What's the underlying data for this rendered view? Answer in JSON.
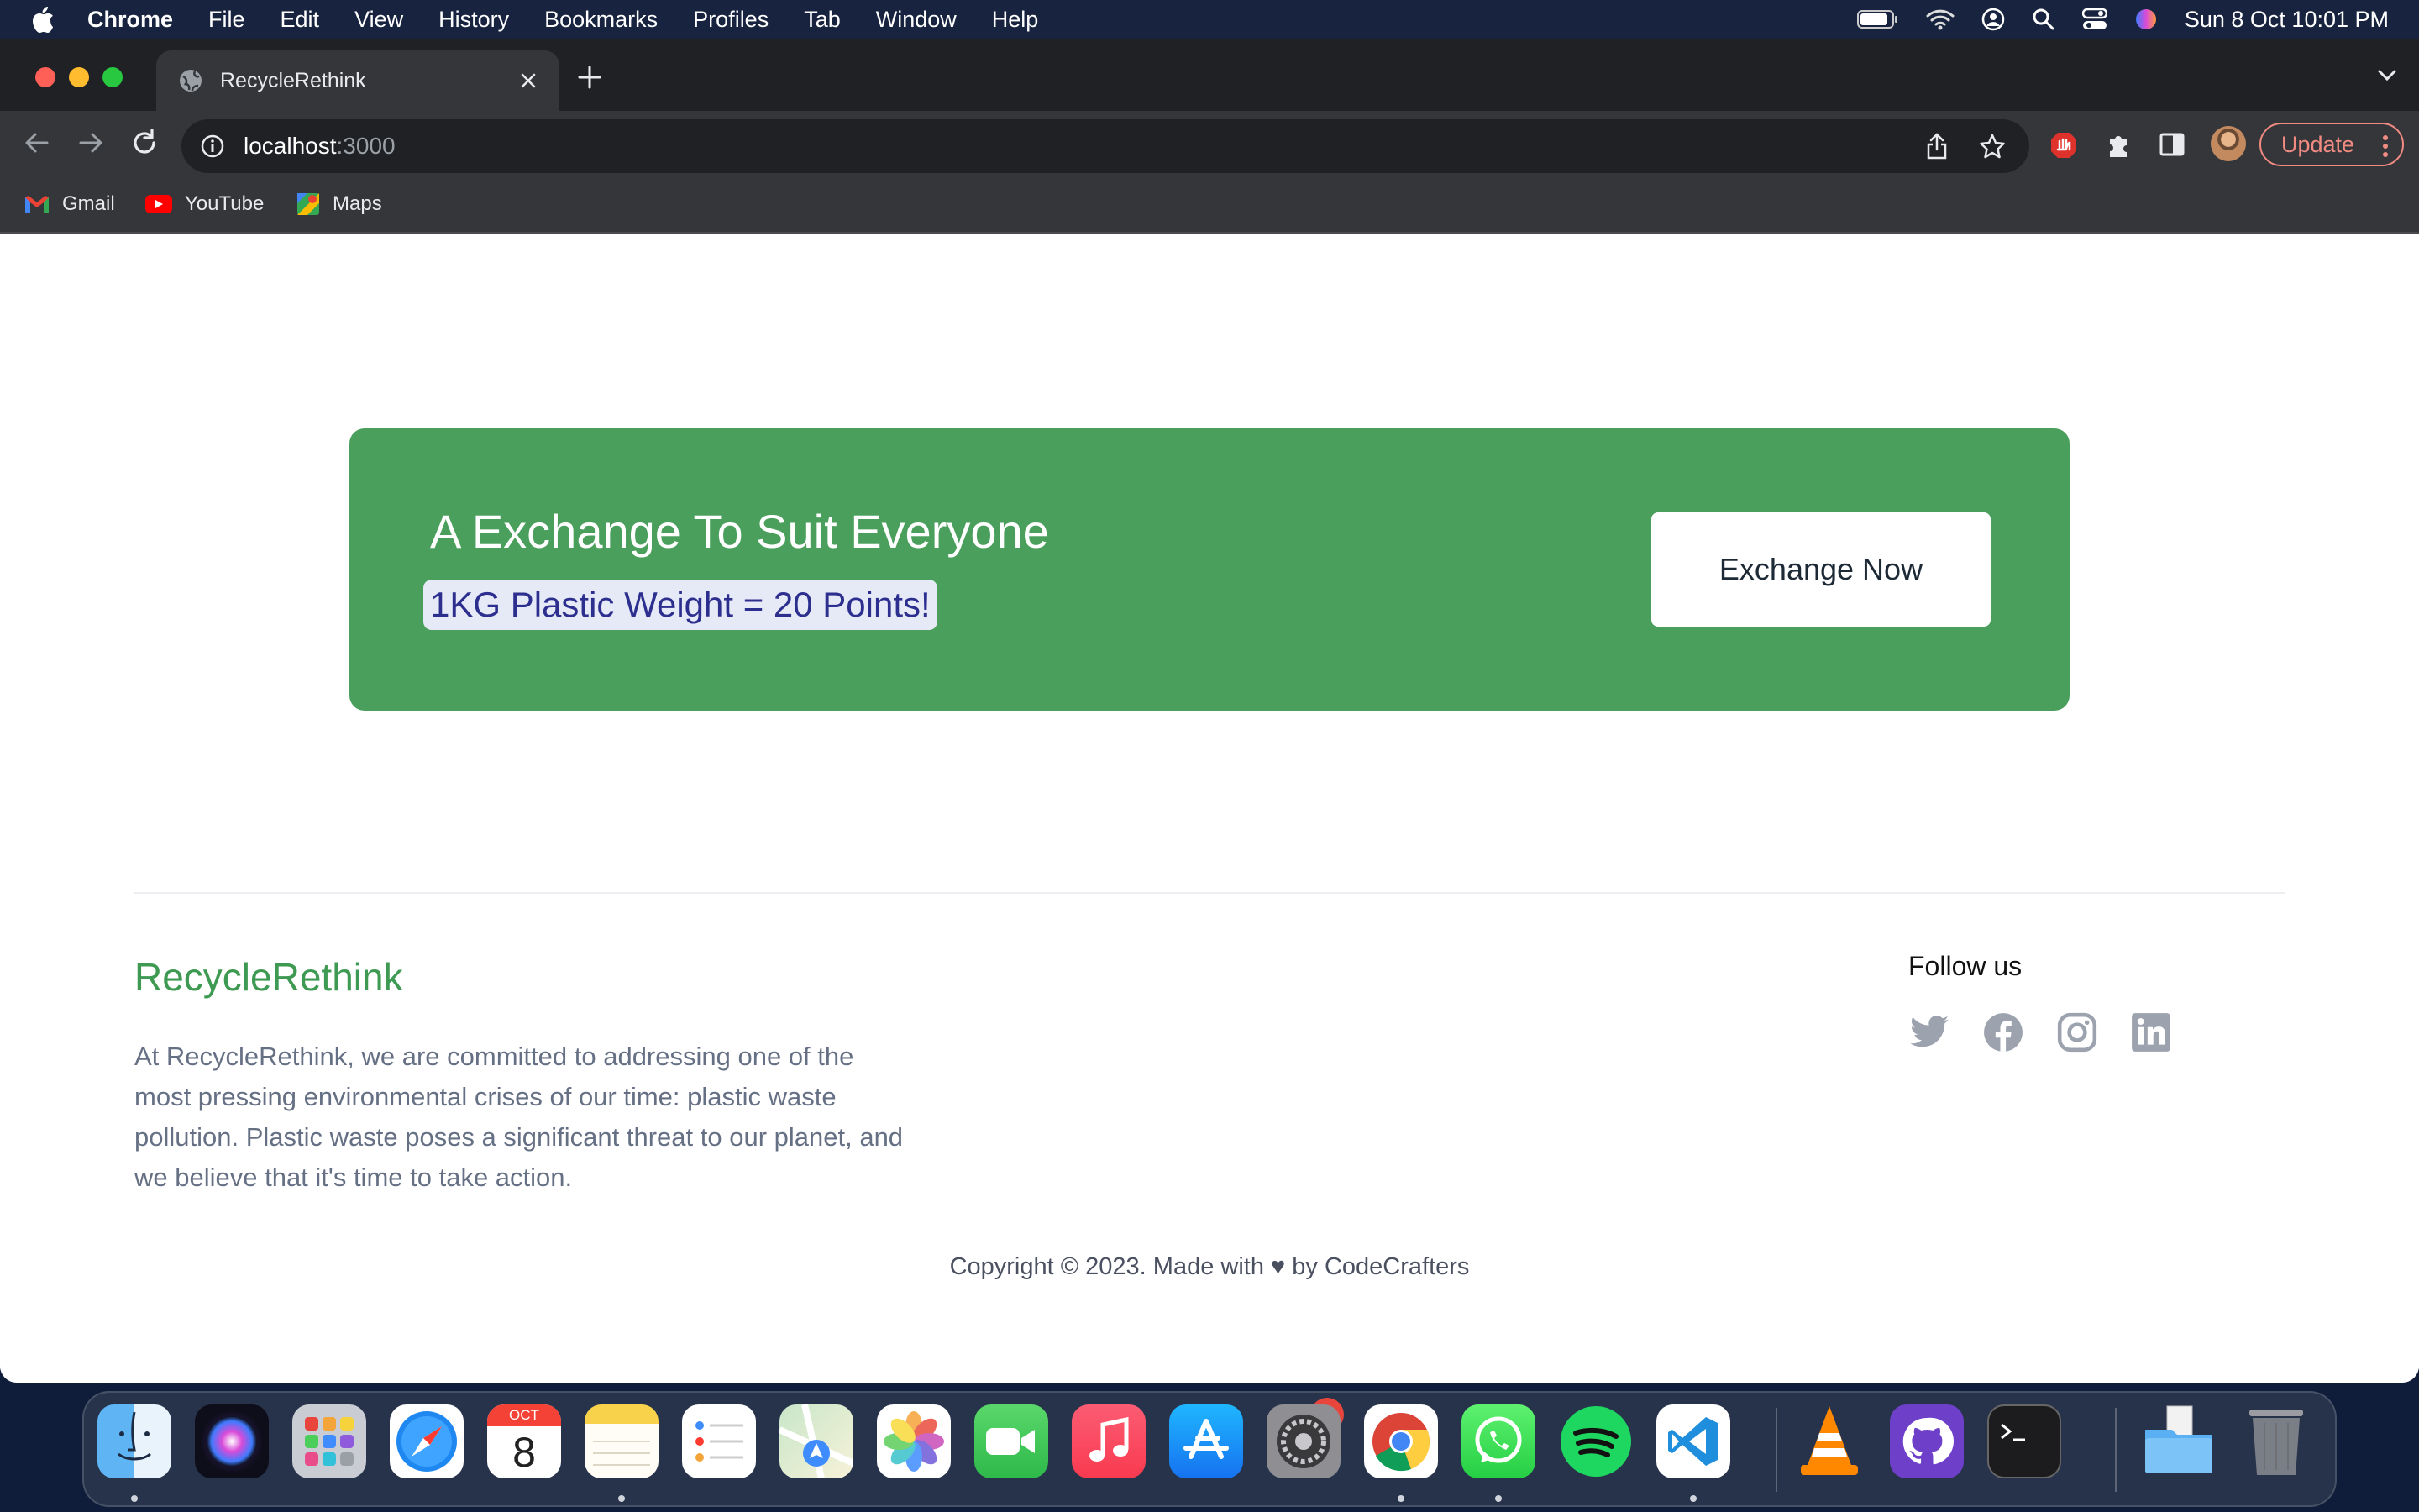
{
  "menubar": {
    "app_name": "Chrome",
    "items": [
      "File",
      "Edit",
      "View",
      "History",
      "Bookmarks",
      "Profiles",
      "Tab",
      "Window",
      "Help"
    ],
    "clock": "Sun 8 Oct  10:01 PM",
    "status_icons": [
      "battery-icon",
      "wifi-icon",
      "user-icon",
      "spotlight-icon",
      "control-center-icon",
      "siri-icon"
    ]
  },
  "browser": {
    "tab_title": "RecycleRethink",
    "url_host": "localhost",
    "url_port": ":3000",
    "update_label": "Update",
    "bookmarks": [
      "Gmail",
      "YouTube",
      "Maps"
    ]
  },
  "banner": {
    "heading": "A Exchange To Suit Everyone",
    "highlight": "1KG Plastic Weight = 20 Points!",
    "cta": "Exchange Now"
  },
  "footer": {
    "brand": "RecycleRethink",
    "about": "At RecycleRethink, we are committed to addressing one of the most pressing environmental crises of our time: plastic waste pollution. Plastic waste poses a significant threat to our planet, and we believe that it's time to take action.",
    "follow_title": "Follow us",
    "socials": [
      "twitter-icon",
      "facebook-icon",
      "instagram-icon",
      "linkedin-icon"
    ],
    "copyright": "Copyright © 2023. Made with ♥ by CodeCrafters"
  },
  "dock": {
    "apps": [
      "Finder",
      "Siri",
      "Launchpad",
      "Safari",
      "Calendar",
      "Notes",
      "Reminders",
      "Maps",
      "Photos",
      "FaceTime",
      "Music",
      "App Store",
      "System Settings",
      "Chrome",
      "WhatsApp",
      "Spotify",
      "VS Code",
      "VLC",
      "GitHub Desktop",
      "Terminal",
      "Downloads",
      "Trash"
    ],
    "calendar_month": "OCT",
    "calendar_day": "8",
    "app_store_badge": "1"
  },
  "colors": {
    "banner_green": "#4a9f5c",
    "brand_green": "#3e9a52",
    "highlight_bg": "#e6eaf7",
    "highlight_text": "#2d2f8f"
  }
}
